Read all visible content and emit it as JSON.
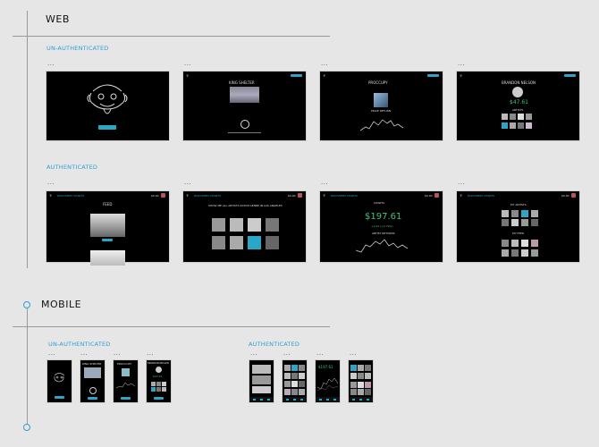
{
  "sections": {
    "web": {
      "title": "WEB",
      "unauth_label": "UN-AUTHENTICATED",
      "auth_label": "AUTHENTICATED",
      "more": "...",
      "unauth_screens": [
        {
          "name": "landing",
          "button": "LOGIN"
        },
        {
          "name": "artist",
          "heading": "KING SHELTER"
        },
        {
          "name": "occupy",
          "heading": "PROCCUPY",
          "subheading": "PRICE RETURN"
        },
        {
          "name": "profile",
          "heading": "BRANDON NELSON",
          "value": "$47.61",
          "artists_label": "ARTISTS"
        }
      ],
      "auth_screens": [
        {
          "name": "feed",
          "nav": [
            "DISCOVERY",
            "CHARTS"
          ],
          "right": "$0.00",
          "heading": "FEED",
          "item1": "KING SHELTER",
          "item1_sub": "NEW PRICE COMING SOON"
        },
        {
          "name": "discover",
          "nav": [
            "DISCOVERY",
            "CHARTS"
          ],
          "right": "$0.00",
          "heading": "SHOW ME ALL ARTISTS IN POP GENRE IN LOS ANGELES"
        },
        {
          "name": "charts",
          "nav": [
            "DISCOVERY",
            "CHARTS"
          ],
          "right": "$0.00",
          "heading": "CHARTS",
          "value": "$197.61",
          "change": "+1.02 (+0.79%)",
          "label": "ARTIST RETURNS"
        },
        {
          "name": "my-artists",
          "nav": [
            "DISCOVERY",
            "CHARTS"
          ],
          "right": "$0.00",
          "heading": "MY ARTISTS",
          "heading2": "MY FEED"
        }
      ]
    },
    "mobile": {
      "title": "MOBILE",
      "unauth_label": "UN-AUTHENTICATED",
      "auth_label": "AUTHENTICATED",
      "more": "...",
      "unauth_screens": [
        {
          "name": "m-landing"
        },
        {
          "name": "m-artist",
          "heading": "KING SHELTER"
        },
        {
          "name": "m-occupy",
          "heading": "PROCCUPY"
        },
        {
          "name": "m-profile",
          "heading": "BRANDON NELSON",
          "value": "$47.61"
        }
      ],
      "auth_screens": [
        {
          "name": "m-feed"
        },
        {
          "name": "m-discover"
        },
        {
          "name": "m-charts",
          "value": "$197.61"
        },
        {
          "name": "m-my-artists"
        }
      ]
    }
  },
  "colors": {
    "accent": "#2d9fd6",
    "screen_bg": "#000000",
    "teal": "#2aa6c7",
    "money_green": "#3ec47a"
  }
}
